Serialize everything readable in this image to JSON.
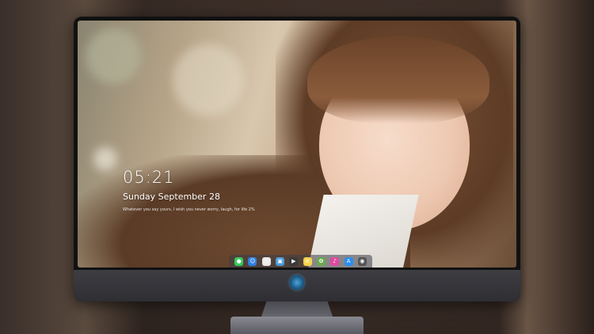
{
  "lockscreen": {
    "time": "05:21",
    "date": "Sunday September  28",
    "quote": "Whatever you say yours, I wish you never worry, laugh, for life 2%"
  },
  "dock": {
    "apps": [
      {
        "name": "messages-icon",
        "glyph": "●",
        "color": "#38c95a"
      },
      {
        "name": "finder-icon",
        "glyph": "☺",
        "color": "#2f7fe0"
      },
      {
        "name": "clock-icon",
        "glyph": "◴",
        "color": "#e8e8e8"
      },
      {
        "name": "preview-icon",
        "glyph": "▣",
        "color": "#4a9ad8"
      },
      {
        "name": "film-icon",
        "glyph": "▶",
        "color": "#3a3a3a"
      },
      {
        "name": "notes-icon",
        "glyph": "≡",
        "color": "#f5d24a"
      },
      {
        "name": "photos-icon",
        "glyph": "✿",
        "color": "#6aa84f"
      },
      {
        "name": "music-icon",
        "glyph": "♪",
        "color": "#e04aa0"
      },
      {
        "name": "appstore-icon",
        "glyph": "A",
        "color": "#2a8ef0"
      },
      {
        "name": "camera-icon",
        "glyph": "◉",
        "color": "#555555"
      }
    ]
  },
  "brand": {
    "logo_color": "#3a9ad8"
  }
}
